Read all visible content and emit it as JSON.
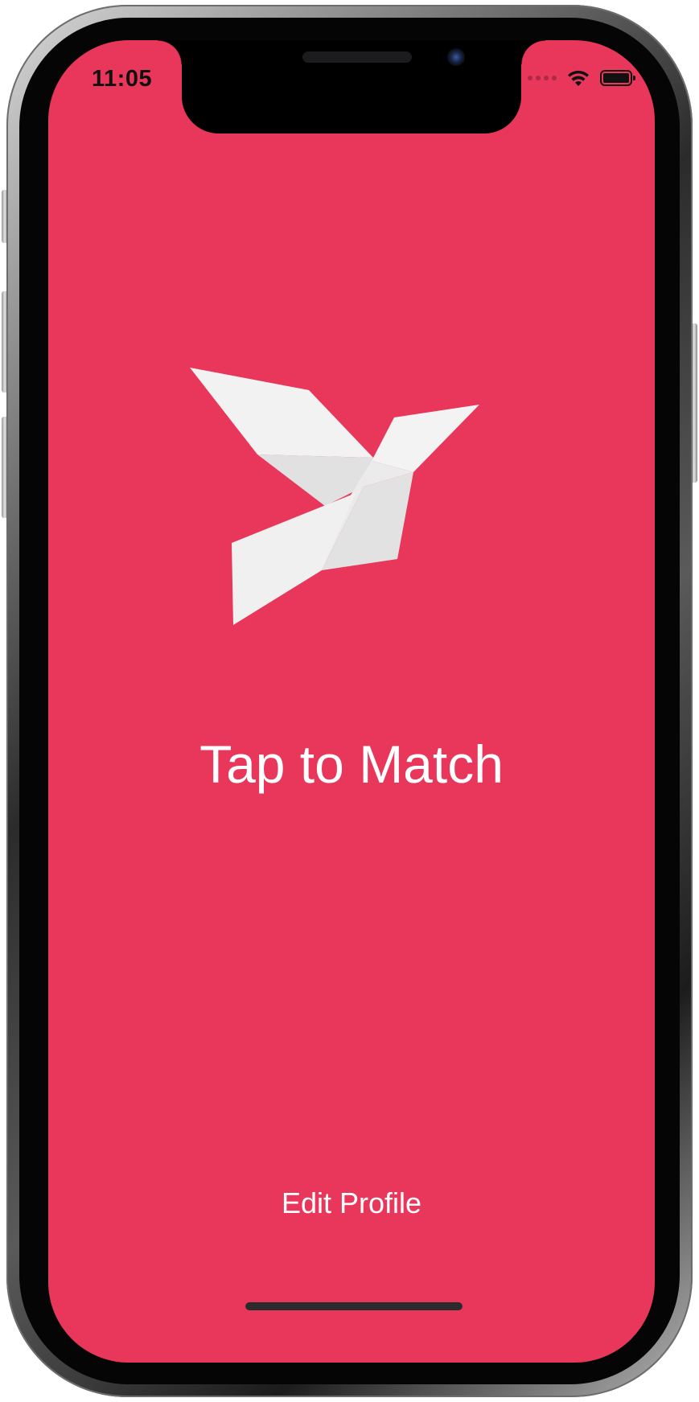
{
  "colors": {
    "screen_background": "#E8375A",
    "text": "#FFFFFF",
    "frame_dark": "#050505",
    "logo_light": "#F2F1F1",
    "logo_shadow": "#E1E0E0"
  },
  "status_bar": {
    "time": "11:05",
    "icons": [
      "signal-dots-icon",
      "wifi-icon",
      "battery-icon"
    ]
  },
  "main": {
    "logo_icon": "bird-logo-icon",
    "title": "Tap to Match",
    "edit_profile_label": "Edit Profile"
  }
}
